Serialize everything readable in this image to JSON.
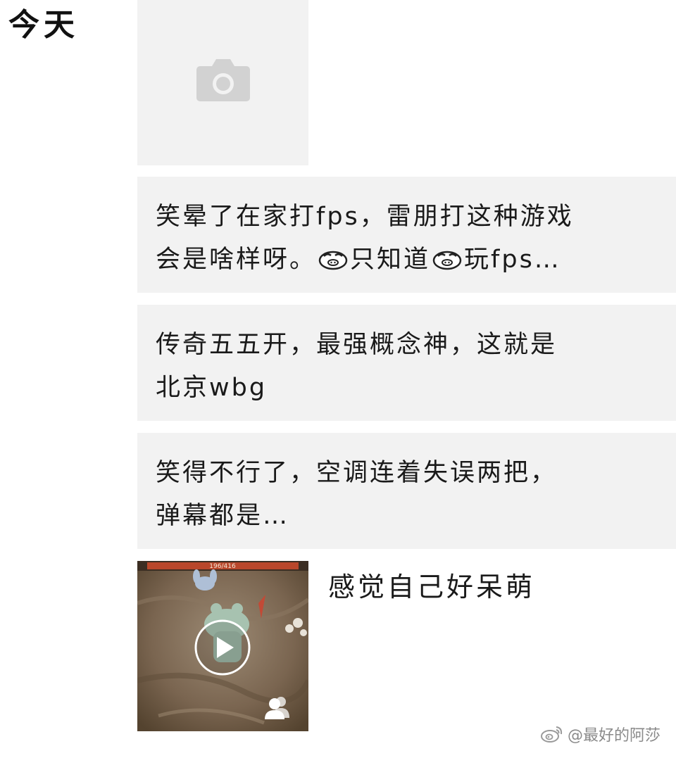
{
  "feed": {
    "date_label": "今天",
    "photo_placeholder": {
      "icon": "camera-icon"
    },
    "posts": [
      {
        "line1": "笑晕了在家打fps，雷朋打这种游戏",
        "line2_a": "会是啥样呀。",
        "line2_b": "只知道",
        "line2_c": "玩fps…"
      },
      {
        "text": "传奇五五开，最强概念神，这就是\n北京wbg"
      },
      {
        "text": "笑得不行了，空调连着失误两把，\n弹幕都是…"
      }
    ],
    "video_post": {
      "thumb_counter": "196/416",
      "caption": "感觉自己好呆萌",
      "icons": [
        "play-icon",
        "friends-visibility-icon"
      ]
    }
  },
  "watermark": {
    "text": "@最好的阿莎",
    "icon": "weibo-logo-icon"
  },
  "colors": {
    "background": "#ffffff",
    "post_bg": "#f2f2f2",
    "text": "#1a1a1a",
    "watermark": "#8a8a8a"
  }
}
